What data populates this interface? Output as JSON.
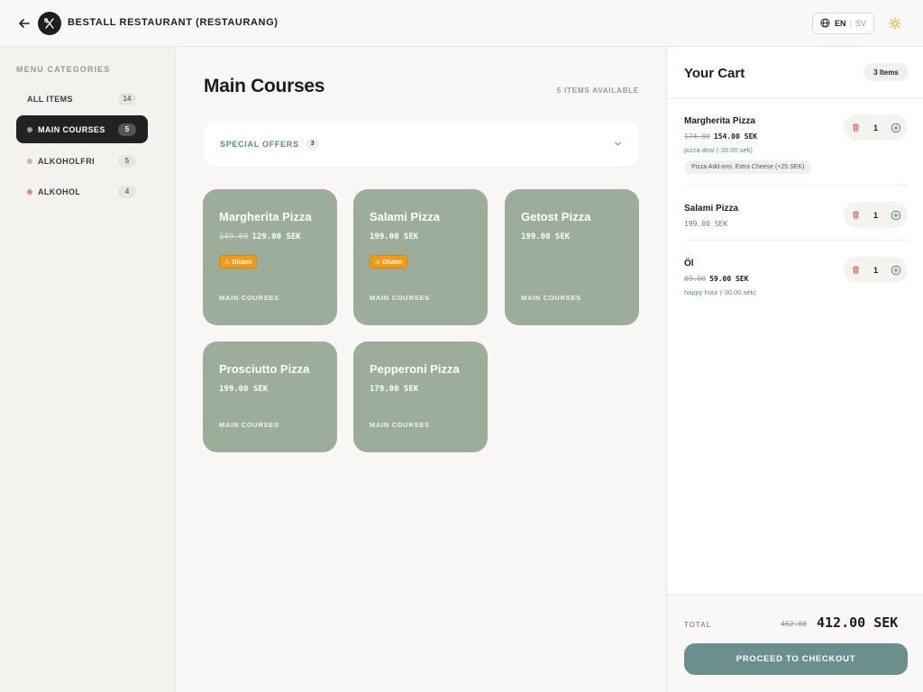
{
  "header": {
    "title": "BESTALL RESTAURANT (RESTAURANG)",
    "lang_active": "EN",
    "lang_separator": "|",
    "lang_other": "SV",
    "icons": [
      "back-arrow-icon",
      "utensils-icon",
      "globe-icon",
      "sun-icon"
    ]
  },
  "sidebar": {
    "title": "MENU CATEGORIES",
    "items": [
      {
        "label": "ALL ITEMS",
        "count": "14",
        "dot": ""
      },
      {
        "label": "MAIN COURSES",
        "count": "5",
        "dot": "#9a9a9a",
        "active": true
      },
      {
        "label": "ALKOHOLFRI",
        "count": "5",
        "dot": "#d5b0a0"
      },
      {
        "label": "ALKOHOL",
        "count": "4",
        "dot": "#e28a8a"
      }
    ]
  },
  "main": {
    "title": "Main Courses",
    "items_available": "5 ITEMS AVAILABLE",
    "offers": {
      "label": "SPECIAL OFFERS",
      "count": "3"
    },
    "cards": [
      {
        "name": "Margherita Pizza",
        "old_price": "149.00",
        "price": "129.00 SEK",
        "allergen": "⚠ Gluten",
        "category": "MAIN COURSES"
      },
      {
        "name": "Salami Pizza",
        "old_price": "",
        "price": "199.00 SEK",
        "allergen": "⚠ Gluten",
        "category": "MAIN COURSES"
      },
      {
        "name": "Getost Pizza",
        "old_price": "",
        "price": "199.00 SEK",
        "allergen": "",
        "category": "MAIN COURSES"
      },
      {
        "name": "Prosciutto Pizza",
        "old_price": "",
        "price": "199.00 SEK",
        "allergen": "",
        "category": "MAIN COURSES"
      },
      {
        "name": "Pepperoni Pizza",
        "old_price": "",
        "price": "179.00 SEK",
        "allergen": "",
        "category": "MAIN COURSES"
      }
    ]
  },
  "cart": {
    "title": "Your Cart",
    "count": "3 Items",
    "items": [
      {
        "name": "Margherita Pizza",
        "old_price": "174.00",
        "price": "154.00 SEK",
        "deal": "pizza deal (-20.00 sek)",
        "addon": "Pizza Add-ons: Extra Cheese (+25 SEK)",
        "qty": "1"
      },
      {
        "name": "Salami Pizza",
        "old_price": "",
        "price": "199.00 SEK",
        "deal": "",
        "addon": "",
        "qty": "1"
      },
      {
        "name": "Öl",
        "old_price": "89.00",
        "price": "59.00 SEK",
        "deal": "happy hour (-30.00 sek)",
        "addon": "",
        "qty": "1"
      }
    ],
    "total_label": "TOTAL",
    "total_old": "462.00",
    "total": "412.00 SEK",
    "checkout_label": "PROCEED TO CHECKOUT"
  },
  "colors": {
    "card_bg": "#9cad9c",
    "accent": "#6a8f8c",
    "allergen": "#f29b16",
    "delete": "#e05a5a"
  }
}
